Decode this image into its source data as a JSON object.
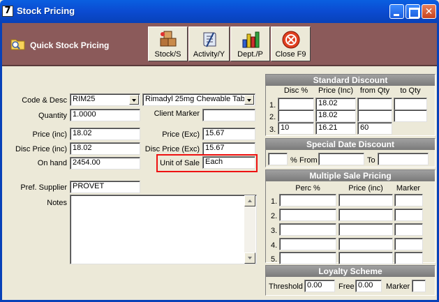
{
  "window": {
    "title": "Stock Pricing"
  },
  "toolbar": {
    "quick_label": "Quick Stock Pricing",
    "buttons": {
      "stock": "Stock/S",
      "activity": "Activity/Y",
      "dept": "Dept./P",
      "close": "Close F9"
    }
  },
  "form": {
    "code_desc_label": "Code & Desc",
    "code_value": "RIM25",
    "desc_value": "Rimadyl 25mg Chewable Tab",
    "quantity_label": "Quantity",
    "quantity_value": "1.0000",
    "client_marker_label": "Client Marker",
    "client_marker_value": "",
    "price_inc_label": "Price (inc)",
    "price_inc_value": "18.02",
    "price_exc_label": "Price (Exc)",
    "price_exc_value": "15.67",
    "disc_price_inc_label": "Disc Price (inc)",
    "disc_price_inc_value": "18.02",
    "disc_price_exc_label": "Disc Price (Exc)",
    "disc_price_exc_value": "15.67",
    "on_hand_label": "On hand",
    "on_hand_value": "2454.00",
    "unit_of_sale_label": "Unit of Sale",
    "unit_of_sale_value": "Each",
    "pref_supplier_label": "Pref. Supplier",
    "pref_supplier_value": "PROVET",
    "notes_label": "Notes",
    "notes_value": ""
  },
  "standard_discount": {
    "title": "Standard Discount",
    "headers": [
      "Disc %",
      "Price (Inc)",
      "from Qty",
      "to Qty"
    ],
    "rows": [
      {
        "n": "1.",
        "disc": "",
        "price": "18.02",
        "from": "",
        "to": ""
      },
      {
        "n": "2.",
        "disc": "",
        "price": "18.02",
        "from": "",
        "to": ""
      },
      {
        "n": "3.",
        "disc": "10",
        "price": "16.21",
        "from": "60",
        "to": ""
      }
    ]
  },
  "special_date_discount": {
    "title": "Special Date Discount",
    "percent_label": "%",
    "from_label": "From",
    "to_label": "To",
    "percent_value": "",
    "from_value": "",
    "to_value": ""
  },
  "multiple_sale_pricing": {
    "title": "Multiple Sale Pricing",
    "headers": [
      "Perc %",
      "Price (inc)",
      "Marker"
    ],
    "rows": [
      {
        "n": "1.",
        "perc": "",
        "price": "",
        "marker": ""
      },
      {
        "n": "2.",
        "perc": "",
        "price": "",
        "marker": ""
      },
      {
        "n": "3.",
        "perc": "",
        "price": "",
        "marker": ""
      },
      {
        "n": "4.",
        "perc": "",
        "price": "",
        "marker": ""
      },
      {
        "n": "5.",
        "perc": "",
        "price": "",
        "marker": ""
      }
    ]
  },
  "loyalty_scheme": {
    "title": "Loyalty Scheme",
    "threshold_label": "Threshold",
    "threshold_value": "0.00",
    "free_label": "Free",
    "free_value": "0.00",
    "marker_label": "Marker",
    "marker_value": ""
  },
  "icons": {
    "app": "app-7-icon",
    "quick": "folder-icon",
    "stock": "boxes-icon",
    "activity": "scroll-icon",
    "dept": "bar-chart-icon",
    "close": "close-circle-icon"
  },
  "colors": {
    "titlebar": "#0b4bd1",
    "toolbar": "#8b5a5a",
    "highlight": "#e11111"
  }
}
